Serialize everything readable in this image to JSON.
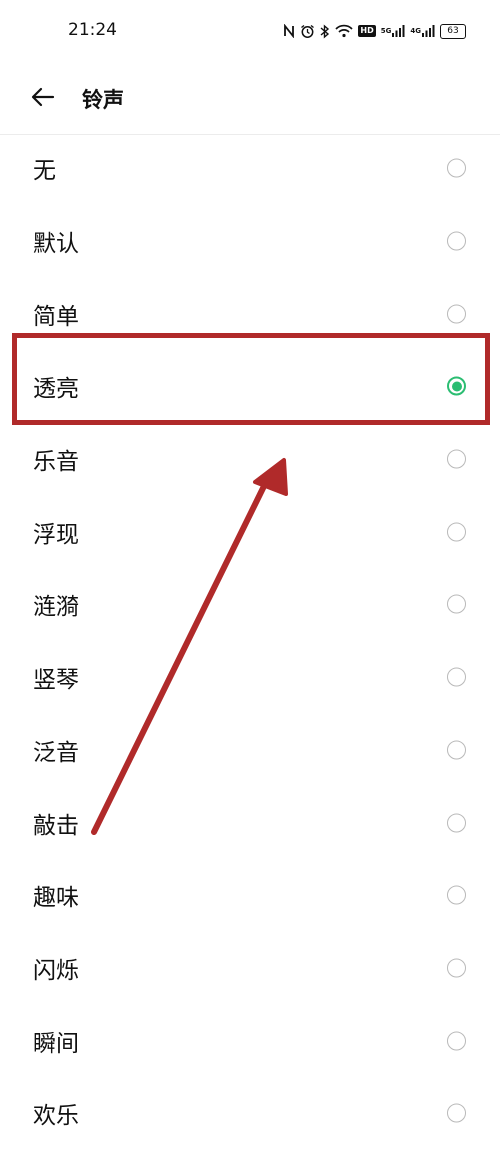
{
  "status_bar": {
    "time": "21:24",
    "hd_label": "HD",
    "net1": "5G",
    "net2": "4G",
    "battery": "63"
  },
  "header": {
    "title": "铃声"
  },
  "ringtones": [
    {
      "label": "无",
      "selected": false
    },
    {
      "label": "默认",
      "selected": false
    },
    {
      "label": "简单",
      "selected": false
    },
    {
      "label": "透亮",
      "selected": true
    },
    {
      "label": "乐音",
      "selected": false
    },
    {
      "label": "浮现",
      "selected": false
    },
    {
      "label": "涟漪",
      "selected": false
    },
    {
      "label": "竖琴",
      "selected": false
    },
    {
      "label": "泛音",
      "selected": false
    },
    {
      "label": "敲击",
      "selected": false
    },
    {
      "label": "趣味",
      "selected": false
    },
    {
      "label": "闪烁",
      "selected": false
    },
    {
      "label": "瞬间",
      "selected": false
    },
    {
      "label": "欢乐",
      "selected": false
    }
  ],
  "colors": {
    "accent": "#2bbd72",
    "annotation": "#b02a2a"
  }
}
